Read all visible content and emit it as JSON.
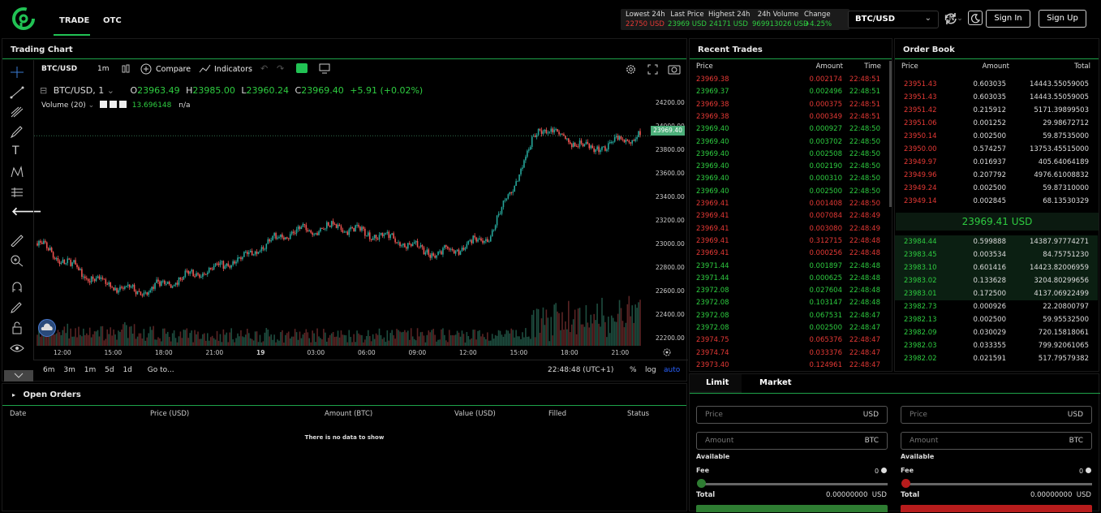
{
  "nav": {
    "trade": "TRADE",
    "otc": "OTC"
  },
  "stats": [
    {
      "label": "Lowest 24h",
      "value": "22750 USD",
      "color": "#e53935"
    },
    {
      "label": "Last Price",
      "value": "23969 USD",
      "color": "#2ecc40"
    },
    {
      "label": "Highest 24h",
      "value": "24171 USD",
      "color": "#2ecc40"
    },
    {
      "label": "24h Volume",
      "value": "969913026 USD",
      "color": "#2ecc40"
    },
    {
      "label": "Change",
      "value": "+4.25%",
      "color": "#2ecc40"
    }
  ],
  "header": {
    "pair": "BTC/USD",
    "lang": "EN",
    "signin": "Sign In",
    "signup": "Sign Up"
  },
  "chart": {
    "title": "Trading Chart",
    "symbol": "BTC/USD",
    "interval": "1m",
    "compare": "Compare",
    "indicators": "Indicators",
    "legend_symbol": "BTC/USD, 1",
    "o_label": "O",
    "o": "23963.49",
    "h_label": "H",
    "h": "23985.00",
    "l_label": "L",
    "l": "23960.24",
    "c_label": "C",
    "c": "23969.40",
    "change": "+5.91 (+0.02%)",
    "volume_label": "Volume (20)",
    "volume_value": "13.696148",
    "volume_na": "n/a",
    "last_price_tag": "23969.40",
    "y_ticks": [
      "24200.00",
      "24000.00",
      "23800.00",
      "23600.00",
      "23400.00",
      "23200.00",
      "23000.00",
      "22800.00",
      "22600.00",
      "22400.00",
      "22200.00"
    ],
    "x_ticks": [
      "12:00",
      "15:00",
      "18:00",
      "21:00",
      "19",
      "03:00",
      "06:00",
      "09:00",
      "12:00",
      "15:00",
      "18:00",
      "21:00"
    ],
    "ranges": [
      "6m",
      "3m",
      "1m",
      "5d",
      "1d"
    ],
    "goto": "Go to...",
    "time": "22:48:48 (UTC+1)",
    "pct": "%",
    "log": "log",
    "auto": "auto"
  },
  "chart_data": {
    "type": "candlestick",
    "ylim": [
      22150,
      24300
    ],
    "x": [
      "12:00",
      "15:00",
      "18:00",
      "21:00",
      "19",
      "03:00",
      "06:00",
      "09:00",
      "12:00",
      "15:00",
      "18:00",
      "21:00"
    ],
    "close_approx": [
      23000,
      22700,
      22550,
      22700,
      22850,
      23100,
      23150,
      23050,
      22900,
      23050,
      24050,
      23850,
      23969
    ]
  },
  "trades": {
    "title": "Recent Trades",
    "cols": [
      "Price",
      "Amount",
      "Time"
    ],
    "rows": [
      [
        "23969.38",
        "0.002174",
        "22:48:51",
        "r"
      ],
      [
        "23969.37",
        "0.002496",
        "22:48:51",
        "g"
      ],
      [
        "23969.38",
        "0.000375",
        "22:48:51",
        "r"
      ],
      [
        "23969.38",
        "0.000349",
        "22:48:51",
        "r"
      ],
      [
        "23969.40",
        "0.000927",
        "22:48:50",
        "g"
      ],
      [
        "23969.40",
        "0.003702",
        "22:48:50",
        "g"
      ],
      [
        "23969.40",
        "0.002508",
        "22:48:50",
        "g"
      ],
      [
        "23969.40",
        "0.002190",
        "22:48:50",
        "g"
      ],
      [
        "23969.40",
        "0.000310",
        "22:48:50",
        "g"
      ],
      [
        "23969.40",
        "0.002500",
        "22:48:50",
        "g"
      ],
      [
        "23969.41",
        "0.001408",
        "22:48:50",
        "r"
      ],
      [
        "23969.41",
        "0.007084",
        "22:48:49",
        "r"
      ],
      [
        "23969.41",
        "0.003080",
        "22:48:49",
        "r"
      ],
      [
        "23969.41",
        "0.312715",
        "22:48:48",
        "r"
      ],
      [
        "23969.41",
        "0.000256",
        "22:48:48",
        "r"
      ],
      [
        "23971.44",
        "0.001897",
        "22:48:48",
        "g"
      ],
      [
        "23971.44",
        "0.000625",
        "22:48:48",
        "g"
      ],
      [
        "23972.08",
        "0.027604",
        "22:48:48",
        "g"
      ],
      [
        "23972.08",
        "0.103147",
        "22:48:48",
        "g"
      ],
      [
        "23972.08",
        "0.067531",
        "22:48:47",
        "g"
      ],
      [
        "23972.08",
        "0.002500",
        "22:48:47",
        "g"
      ],
      [
        "23974.75",
        "0.065376",
        "22:48:47",
        "r"
      ],
      [
        "23974.74",
        "0.033376",
        "22:48:47",
        "r"
      ],
      [
        "23973.40",
        "0.124961",
        "22:48:47",
        "r"
      ]
    ]
  },
  "orderbook": {
    "title": "Order Book",
    "cols": [
      "Price",
      "Amount",
      "Total"
    ],
    "asks": [
      [
        "23951.43",
        "0.603035",
        "14443.55059005"
      ],
      [
        "23951.43",
        "0.603035",
        "14443.55059005"
      ],
      [
        "23951.42",
        "0.215912",
        "5171.39899503"
      ],
      [
        "23951.06",
        "0.001252",
        "29.98672712"
      ],
      [
        "23950.14",
        "0.002500",
        "59.87535000"
      ],
      [
        "23950.00",
        "0.574257",
        "13753.45515000"
      ],
      [
        "23949.97",
        "0.016937",
        "405.64064189"
      ],
      [
        "23949.96",
        "0.207792",
        "4976.61008832"
      ],
      [
        "23949.24",
        "0.002500",
        "59.87310000"
      ],
      [
        "23949.14",
        "0.002845",
        "68.13530329"
      ]
    ],
    "mid": "23969.41 USD",
    "bids": [
      [
        "23984.44",
        "0.599888",
        "14387.97774271"
      ],
      [
        "23983.45",
        "0.003534",
        "84.75751230"
      ],
      [
        "23983.10",
        "0.601416",
        "14423.82006959"
      ],
      [
        "23983.02",
        "0.133628",
        "3204.80299656"
      ],
      [
        "23983.01",
        "0.172500",
        "4137.06922499"
      ],
      [
        "23982.73",
        "0.000926",
        "22.20800797"
      ],
      [
        "23982.13",
        "0.002500",
        "59.95532500"
      ],
      [
        "23982.09",
        "0.030029",
        "720.15818061"
      ],
      [
        "23982.03",
        "0.033355",
        "799.92061065"
      ],
      [
        "23982.02",
        "0.021591",
        "517.79579382"
      ]
    ]
  },
  "orders": {
    "title": "Open Orders",
    "cols": [
      "Date",
      "Price (USD)",
      "Amount (BTC)",
      "Value (USD)",
      "Filled",
      "Status"
    ],
    "empty": "There is no data to show"
  },
  "form": {
    "tab_limit": "Limit",
    "tab_market": "Market",
    "price_ph": "Price",
    "amount_ph": "Amount",
    "usd": "USD",
    "btc": "BTC",
    "available": "Available",
    "fee": "Fee",
    "fee_val": "0",
    "total": "Total",
    "total_val": "0.00000000",
    "total_cur": "USD"
  }
}
